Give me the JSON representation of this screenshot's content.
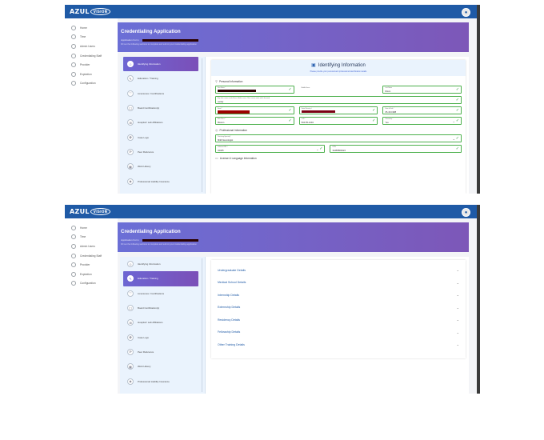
{
  "app": {
    "logo_text": "AZUL",
    "logo_badge": "VISION"
  },
  "nav": {
    "items": [
      {
        "label": "Home"
      },
      {
        "label": "Time"
      },
      {
        "label": "Admin Users"
      },
      {
        "label": "Credentialing Staff"
      },
      {
        "label": "Provider"
      },
      {
        "label": "Expiration"
      },
      {
        "label": "Configuration"
      }
    ]
  },
  "banner": {
    "title": "Credentialing Application",
    "subtitle_prefix": "Application Form",
    "note": "Fill out the following sections to complete and submit your credentialing application"
  },
  "steps": [
    {
      "label": "Identifying Information",
      "icon": "☺"
    },
    {
      "label": "Education / Training",
      "icon": "✎"
    },
    {
      "label": "Licensures / Certifications",
      "icon": "♡"
    },
    {
      "label": "Board Certification(s)",
      "icon": "☐"
    },
    {
      "label": "Hospital / Lab Affiliations",
      "icon": "⊞"
    },
    {
      "label": "Case Logs",
      "icon": "✿"
    },
    {
      "label": "Peer Reference",
      "icon": "⟳"
    },
    {
      "label": "Work History",
      "icon": "▦"
    },
    {
      "label": "Professional Liability Insurance",
      "icon": "◈"
    }
  ],
  "form": {
    "title": "Identifying Information",
    "subtitle": "Please provide your personal and professional identification details",
    "personal_section": "Personal Information",
    "professional_section": "Professional Information",
    "license_section": "License & Language Information",
    "fields": {
      "first_name": {
        "label": "First Name *"
      },
      "middle_name": {
        "label": "Middle Name"
      },
      "last_name": {
        "label": "Last Name",
        "value": "Dixon"
      },
      "other_names": {
        "label": "Any other names used (Name, Maiden name, Other names under which licensed)",
        "value": "sandy"
      },
      "email": {
        "label": "Email *"
      },
      "ssn": {
        "label": "Social Security #"
      },
      "dob": {
        "label": "Date of Birth *",
        "value": "05-18-1988"
      },
      "birth_place": {
        "label": "Birth Place *",
        "value": "Boston"
      },
      "cell": {
        "label": "Cell #",
        "value": "504-55-4494"
      },
      "citizenship": {
        "label": "Citizenship *",
        "value": "Yes"
      },
      "specialty": {
        "label": "Practicing Specialty *",
        "value": "Mild Neurologist"
      },
      "npi": {
        "label": "Individual NPI #",
        "value": "34465"
      },
      "upin": {
        "label": "UPIN",
        "value": "34465869424"
      }
    }
  },
  "edu_sections": [
    {
      "label": "Undergraduate Details"
    },
    {
      "label": "Medical School Details"
    },
    {
      "label": "Internship Details"
    },
    {
      "label": "Externship Details"
    },
    {
      "label": "Residency Details"
    },
    {
      "label": "Fellowship Details"
    },
    {
      "label": "Other Training Details"
    }
  ],
  "colors": {
    "topbar": "#1f5aa6",
    "banner_start": "#6b6fd6",
    "banner_end": "#7d57b8",
    "valid_border": "#4cb04c",
    "check": "#2e9e3a",
    "link": "#1f5aa6"
  }
}
